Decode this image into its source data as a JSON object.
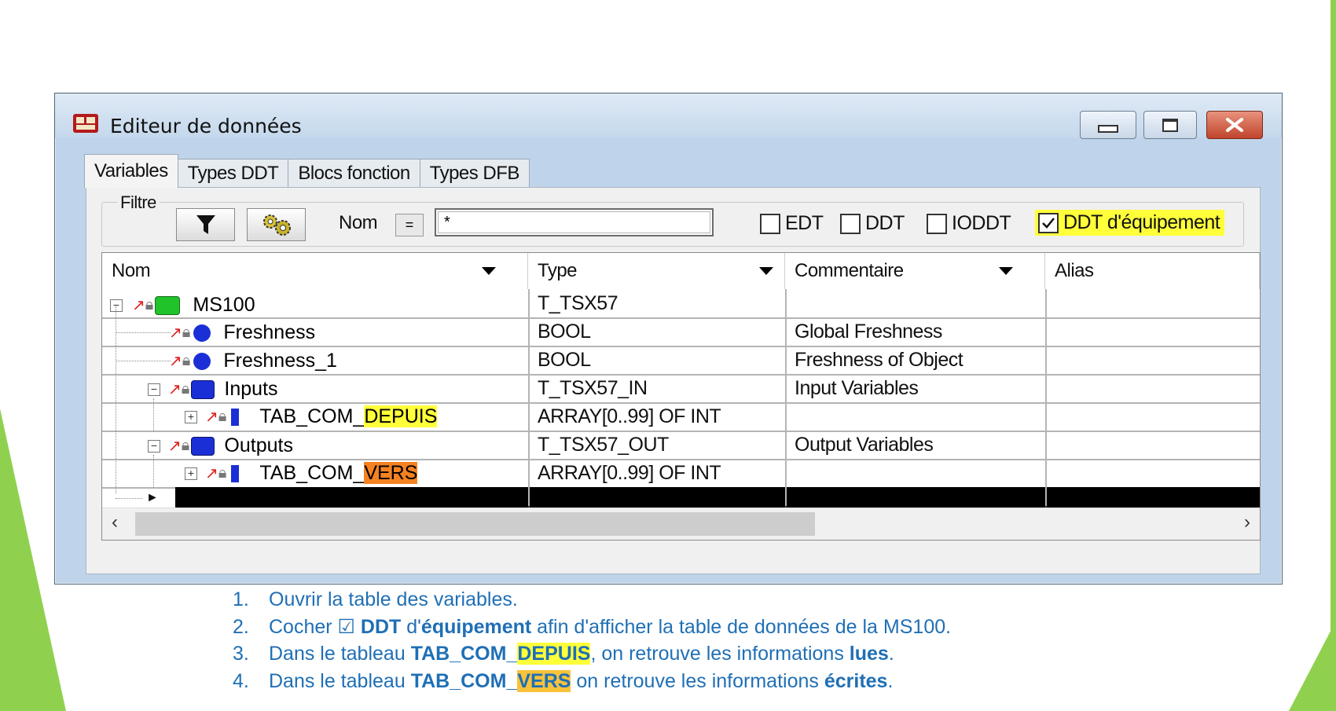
{
  "window": {
    "title": "Editeur de données",
    "controls": [
      "minimize",
      "maximize",
      "close"
    ]
  },
  "tabs": [
    {
      "label": "Variables",
      "active": true
    },
    {
      "label": "Types DDT",
      "active": false
    },
    {
      "label": "Blocs fonction",
      "active": false
    },
    {
      "label": "Types DFB",
      "active": false
    }
  ],
  "filter": {
    "group_label": "Filtre",
    "filter_icon": "funnel-icon",
    "settings_icon": "gears-icon",
    "name_label": "Nom",
    "operator": "=",
    "name_value": "*",
    "checkboxes": [
      {
        "label": "EDT",
        "checked": false
      },
      {
        "label": "DDT",
        "checked": false
      },
      {
        "label": "IODDT",
        "checked": false
      },
      {
        "label": "DDT d'équipement",
        "checked": true,
        "highlight": "#ffff3a"
      }
    ]
  },
  "grid": {
    "columns": [
      "Nom",
      "Type",
      "Commentaire",
      "Alias"
    ],
    "rows": [
      {
        "name": "MS100",
        "type": "T_TSX57",
        "comment": "",
        "alias": ""
      },
      {
        "name": "Freshness",
        "type": "BOOL",
        "comment": "Global Freshness",
        "alias": ""
      },
      {
        "name": "Freshness_1",
        "type": "BOOL",
        "comment": "Freshness of Object",
        "alias": ""
      },
      {
        "name": "Inputs",
        "type": "T_TSX57_IN",
        "comment": "Input Variables",
        "alias": ""
      },
      {
        "name_prefix": "TAB_COM_",
        "name_highlight": "DEPUIS",
        "type": "ARRAY[0..99] OF INT",
        "comment": "",
        "alias": ""
      },
      {
        "name": "Outputs",
        "type": "T_TSX57_OUT",
        "comment": "Output Variables",
        "alias": ""
      },
      {
        "name_prefix": "TAB_COM_",
        "name_highlight": "VERS",
        "type": "ARRAY[0..99] OF INT",
        "comment": "",
        "alias": ""
      }
    ]
  },
  "instructions": {
    "items": [
      {
        "num": "1.",
        "text": "Ouvrir la table des variables."
      },
      {
        "num": "2.",
        "pre": "Cocher ☑ ",
        "b1": "DDT",
        "mid1": " d'",
        "b2": "équipement",
        "post": " afin d'afficher la table de données de la MS100."
      },
      {
        "num": "3.",
        "pre": "Dans le tableau ",
        "b1": "TAB_COM_",
        "hl": "DEPUIS",
        "mid1": ", on retrouve les informations ",
        "b2": "lues",
        "post": "."
      },
      {
        "num": "4.",
        "pre": "Dans le tableau ",
        "b1": "TAB_COM_",
        "hl": "VERS",
        "mid1": " on retrouve les informations ",
        "b2": "écrites",
        "post": "."
      }
    ]
  },
  "colors": {
    "highlight_yellow": "#ffff3a",
    "highlight_orange": "#f58220",
    "text_blue": "#1f6fb5",
    "slide_green": "#8fd14f"
  }
}
